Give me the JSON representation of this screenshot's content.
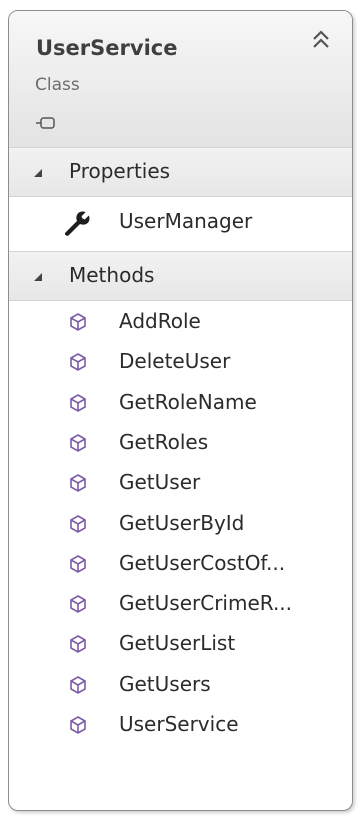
{
  "class_box": {
    "title": "UserService",
    "kind": "Class",
    "class_icon": "class-shape-icon",
    "collapse_icon": "double-chevron-up-icon"
  },
  "sections": [
    {
      "label": "Properties",
      "icon": "triangle-expanded-icon",
      "members": [
        {
          "name": "UserManager",
          "icon": "wrench-icon"
        }
      ]
    },
    {
      "label": "Methods",
      "icon": "triangle-expanded-icon",
      "members": [
        {
          "name": "AddRole",
          "icon": "method-cube-icon"
        },
        {
          "name": "DeleteUser",
          "icon": "method-cube-icon"
        },
        {
          "name": "GetRoleName",
          "icon": "method-cube-icon"
        },
        {
          "name": "GetRoles",
          "icon": "method-cube-icon"
        },
        {
          "name": "GetUser",
          "icon": "method-cube-icon"
        },
        {
          "name": "GetUserById",
          "icon": "method-cube-icon"
        },
        {
          "name": "GetUserCostOf...",
          "icon": "method-cube-icon"
        },
        {
          "name": "GetUserCrimeR...",
          "icon": "method-cube-icon"
        },
        {
          "name": "GetUserList",
          "icon": "method-cube-icon"
        },
        {
          "name": "GetUsers",
          "icon": "method-cube-icon"
        },
        {
          "name": "UserService",
          "icon": "method-cube-icon"
        }
      ]
    }
  ],
  "colors": {
    "method_icon": "#7b5ba6",
    "border": "#8c8c8c",
    "header_bg": "#ebebeb"
  }
}
